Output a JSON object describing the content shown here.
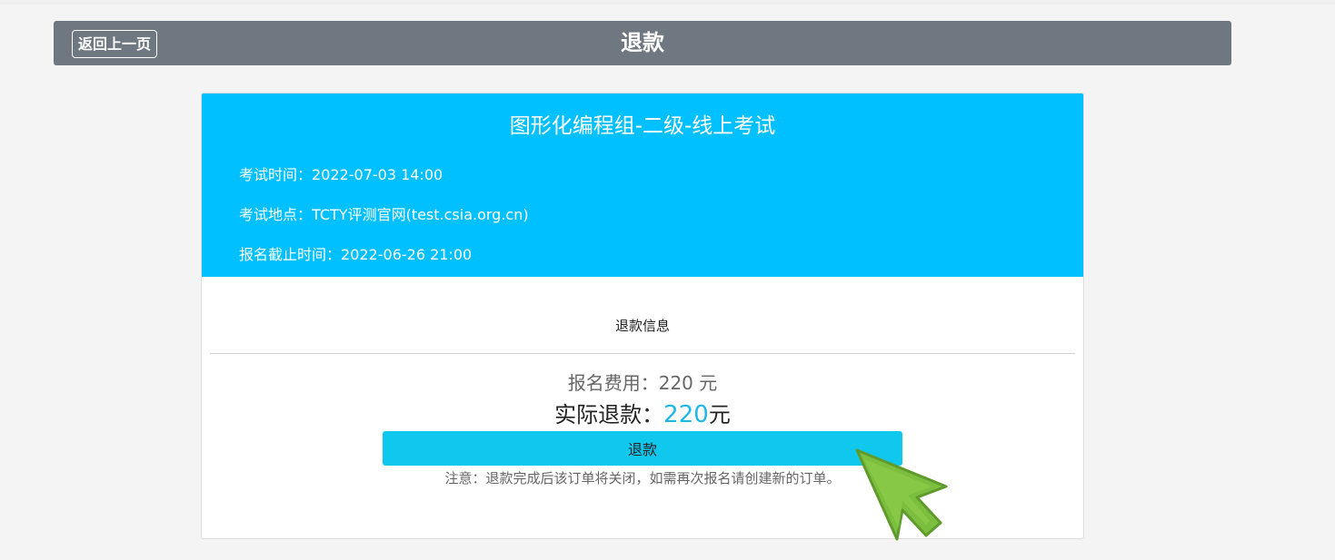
{
  "header": {
    "back_label": "返回上一页",
    "title": "退款"
  },
  "exam": {
    "title": "图形化编程组-二级-线上考试",
    "time_label": "考试时间：",
    "time_value": "2022-07-03 14:00",
    "location_label": "考试地点：",
    "location_value": "TCTY评测官网(test.csia.org.cn)",
    "deadline_label": "报名截止时间：",
    "deadline_value": "2022-06-26 21:00"
  },
  "refund": {
    "section_title": "退款信息",
    "fee_label": "报名费用：",
    "fee_value": "220",
    "fee_unit": "元",
    "actual_label": "实际退款：",
    "actual_value": "220",
    "actual_unit": "元",
    "button_label": "退款",
    "note": "注意：退款完成后该订单将关闭，如需再次报名请创建新的订单。"
  },
  "colors": {
    "header_bg": "#6f7780",
    "card_top_bg": "#00c0ff",
    "button_bg": "#10c8ee",
    "amount_color": "#1eb8e8",
    "cursor_fill": "#7cbf3f"
  },
  "icons": {
    "cursor": "pointer-arrow-icon"
  }
}
